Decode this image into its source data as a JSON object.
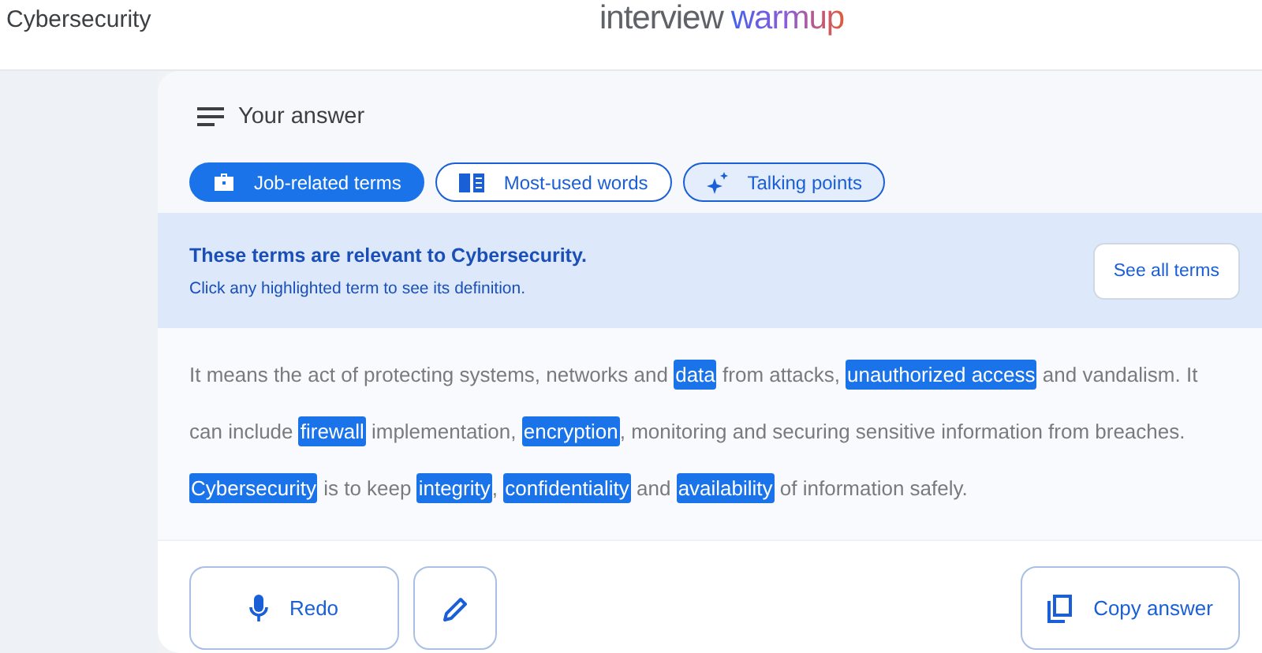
{
  "header": {
    "title": "Cybersecurity",
    "logo": {
      "first": "interview",
      "second": "warmup"
    }
  },
  "answer": {
    "title": "Your answer",
    "tabs": [
      {
        "label": "Job-related terms",
        "selected": true
      },
      {
        "label": "Most-used words",
        "selected": false
      },
      {
        "label": "Talking points",
        "selected": false
      }
    ],
    "notice": {
      "heading": "These terms are relevant to Cybersecurity.",
      "hint": "Click any highlighted term to see its definition.",
      "button": "See all terms"
    },
    "segments": [
      {
        "kind": "text",
        "text": "It means the act of protecting systems, networks and "
      },
      {
        "kind": "term",
        "text": "data"
      },
      {
        "kind": "text",
        "text": " from attacks, "
      },
      {
        "kind": "term",
        "text": "unauthorized access"
      },
      {
        "kind": "text",
        "text": "  and vandalism. It can include "
      },
      {
        "kind": "term",
        "text": "firewall"
      },
      {
        "kind": "text",
        "text": " implementation, "
      },
      {
        "kind": "term",
        "text": "encryption"
      },
      {
        "kind": "text",
        "text": ", monitoring and securing sensitive information from breaches. "
      },
      {
        "kind": "term",
        "text": "Cybersecurity"
      },
      {
        "kind": "text",
        "text": " is to keep "
      },
      {
        "kind": "term",
        "text": "integrity"
      },
      {
        "kind": "text",
        "text": ", "
      },
      {
        "kind": "term",
        "text": "confidentiality"
      },
      {
        "kind": "text",
        "text": " and "
      },
      {
        "kind": "term",
        "text": "availability"
      },
      {
        "kind": "text",
        "text": " of information safely."
      }
    ],
    "actions": {
      "redo": "Redo",
      "copy": "Copy answer"
    }
  }
}
